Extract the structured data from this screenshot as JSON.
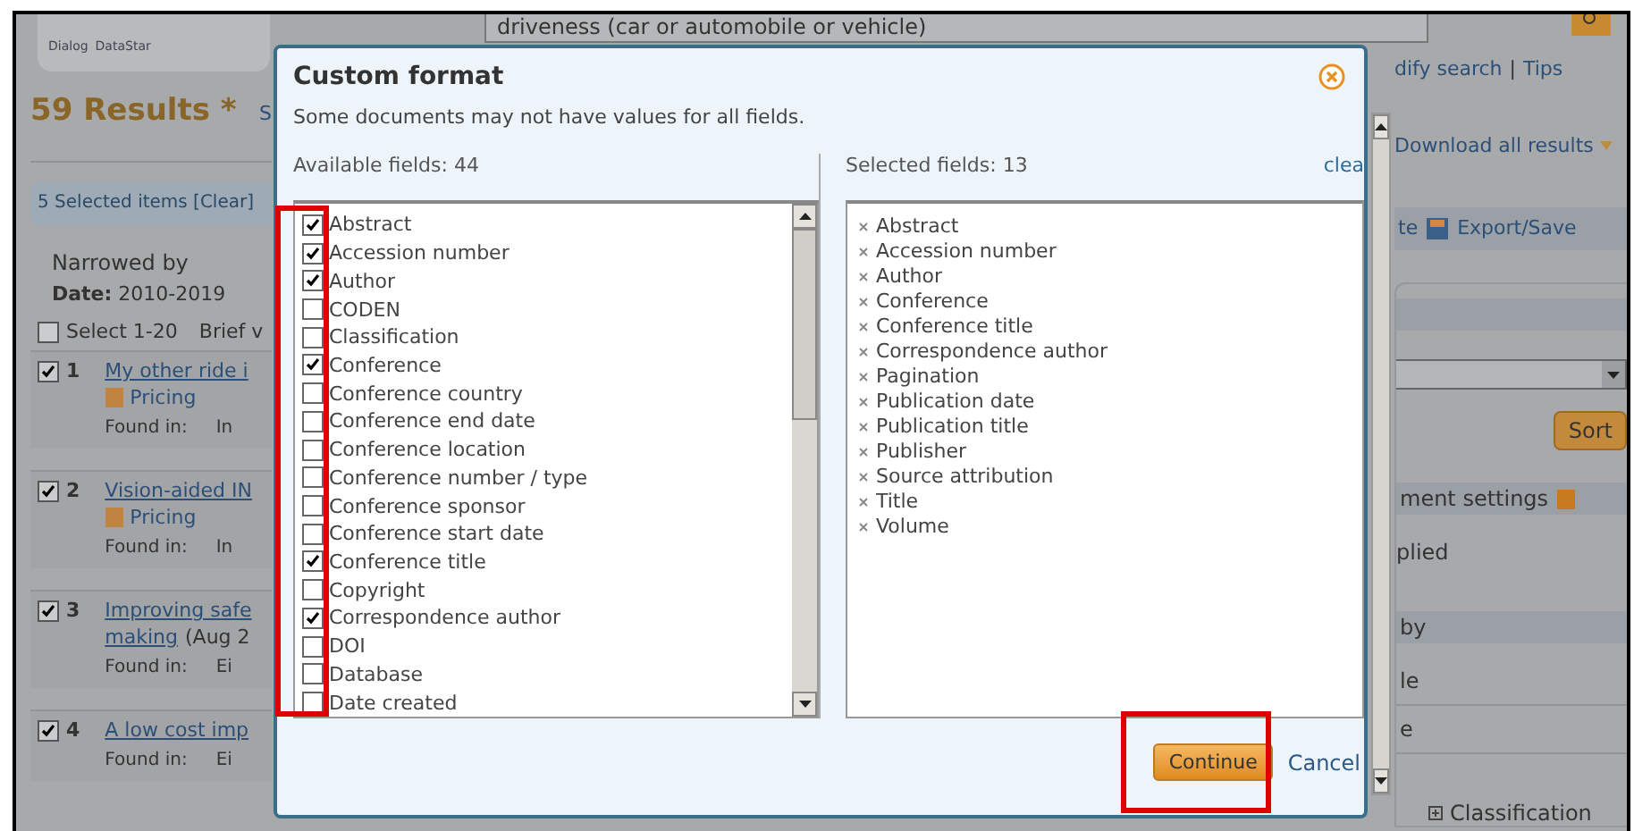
{
  "logo": {
    "brand_1": "Dialog",
    "brand_2": "DataStar"
  },
  "search": {
    "value": "driveness (car or automobile or vehicle)"
  },
  "results_header": {
    "count": "59 Results *",
    "cut_link": "S"
  },
  "selection_bar": {
    "text": "5 Selected items [Clear]"
  },
  "narrowed": {
    "heading": "Narrowed by",
    "filter": "**Date:** 2010-2019"
  },
  "select_all": {
    "label": "Select 1-20",
    "checked": false,
    "view_label": "Brief v"
  },
  "results": [
    {
      "number": "1",
      "checked": true,
      "title_lines": [
        "My other ride i"
      ],
      "pricing": "Pricing",
      "found_label": "Found in:",
      "found_value": "In"
    },
    {
      "number": "2",
      "checked": true,
      "title_lines": [
        "Vision-aided IN"
      ],
      "pricing": "Pricing",
      "found_label": "Found in:",
      "found_value": "In"
    },
    {
      "number": "3",
      "checked": true,
      "title_lines": [
        "Improving safe",
        "making"
      ],
      "date": "(Aug 2",
      "found_label": "Found in:",
      "found_value": "Ei"
    },
    {
      "number": "4",
      "checked": true,
      "title_lines": [
        "A low cost imp"
      ],
      "found_label": "Found in:",
      "found_value": "Ei"
    }
  ],
  "top_links": {
    "modify": "dify search",
    "separator": "|",
    "tips": "Tips"
  },
  "download": "Download all results",
  "toolbar": {
    "cut": "te",
    "export": "Export/Save"
  },
  "sidebar": {
    "sort_button": "Sort",
    "settings_heading": "ment settings",
    "settings_text": "plied",
    "narrow_heading": "by",
    "items": [
      "le",
      "e"
    ],
    "tree_item": "Classification"
  },
  "dialog": {
    "title": "Custom format",
    "note": "Some documents may not have values for all fields.",
    "available_label": "Available fields: 44",
    "selected_label": "Selected fields: 13",
    "clear_link": "clea",
    "available": [
      {
        "label": "Abstract",
        "checked": true
      },
      {
        "label": "Accession number",
        "checked": true
      },
      {
        "label": "Author",
        "checked": true
      },
      {
        "label": "CODEN",
        "checked": false
      },
      {
        "label": "Classification",
        "checked": false
      },
      {
        "label": "Conference",
        "checked": true
      },
      {
        "label": "Conference country",
        "checked": false
      },
      {
        "label": "Conference end date",
        "checked": false
      },
      {
        "label": "Conference location",
        "checked": false
      },
      {
        "label": "Conference number / type",
        "checked": false
      },
      {
        "label": "Conference sponsor",
        "checked": false
      },
      {
        "label": "Conference start date",
        "checked": false
      },
      {
        "label": "Conference title",
        "checked": true
      },
      {
        "label": "Copyright",
        "checked": false
      },
      {
        "label": "Correspondence author",
        "checked": true
      },
      {
        "label": "DOI",
        "checked": false
      },
      {
        "label": "Database",
        "checked": false
      },
      {
        "label": "Date created",
        "checked": false
      }
    ],
    "selected": [
      "Abstract",
      "Accession number",
      "Author",
      "Conference",
      "Conference title",
      "Correspondence author",
      "Pagination",
      "Publication date",
      "Publication title",
      "Publisher",
      "Source attribution",
      "Title",
      "Volume"
    ],
    "continue": "Continue",
    "cancel": "Cancel"
  }
}
